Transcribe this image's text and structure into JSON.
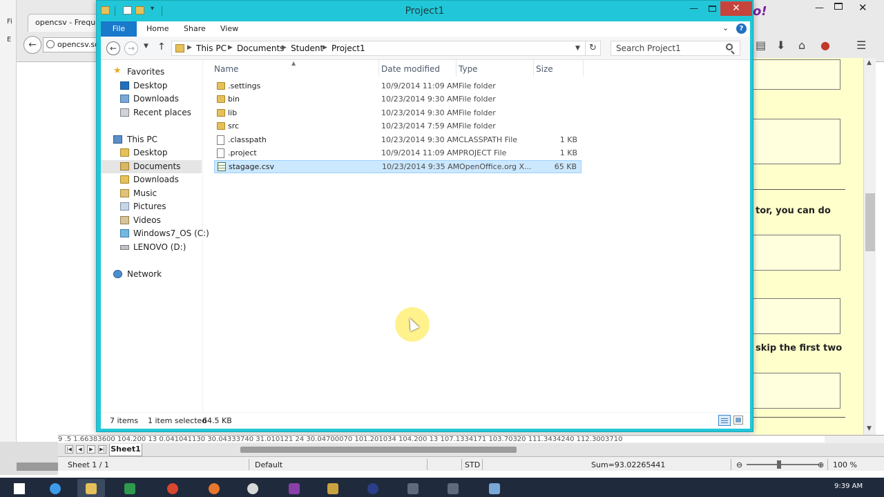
{
  "browser": {
    "menu_letters": [
      "Fi",
      "E"
    ],
    "tab_title": "opencsv - Frequen",
    "url": "opencsv.so",
    "brand_text": "o!",
    "page_text": {
      "line1": "tor, you can do",
      "line2": "skip the first two"
    }
  },
  "explorer": {
    "title": "Project1",
    "close_glyph": "✕",
    "ribbon": {
      "file_tab": "File",
      "tabs": [
        "Home",
        "Share",
        "View"
      ]
    },
    "address": {
      "crumbs": [
        "This PC",
        "Documents",
        "Student",
        "Project1"
      ]
    },
    "search": {
      "placeholder": "Search Project1"
    },
    "nav_pane": {
      "favorites_header": "Favorites",
      "favorites": [
        "Desktop",
        "Downloads",
        "Recent places"
      ],
      "this_pc_header": "This PC",
      "this_pc": [
        "Desktop",
        "Documents",
        "Downloads",
        "Music",
        "Pictures",
        "Videos",
        "Windows7_OS (C:)",
        "LENOVO (D:)"
      ],
      "selected": "Documents",
      "network": "Network"
    },
    "columns": {
      "name": "Name",
      "date": "Date modified",
      "type": "Type",
      "size": "Size"
    },
    "files": [
      {
        "name": ".settings",
        "date": "10/9/2014 11:09 AM",
        "type": "File folder",
        "size": "",
        "icon": "folder-icon"
      },
      {
        "name": "bin",
        "date": "10/23/2014 9:30 AM",
        "type": "File folder",
        "size": "",
        "icon": "folder-icon"
      },
      {
        "name": "lib",
        "date": "10/23/2014 9:30 AM",
        "type": "File folder",
        "size": "",
        "icon": "folder-icon"
      },
      {
        "name": "src",
        "date": "10/23/2014 7:59 AM",
        "type": "File folder",
        "size": "",
        "icon": "folder-icon"
      },
      {
        "name": ".classpath",
        "date": "10/23/2014 9:30 AM",
        "type": "CLASSPATH File",
        "size": "1 KB",
        "icon": "file-icon"
      },
      {
        "name": ".project",
        "date": "10/9/2014 11:09 AM",
        "type": "PROJECT File",
        "size": "1 KB",
        "icon": "file-icon"
      },
      {
        "name": "stagage.csv",
        "date": "10/23/2014 9:35 AM",
        "type": "OpenOffice.org X...",
        "size": "65 KB",
        "icon": "spreadsheet-icon",
        "selected": true
      }
    ],
    "status": {
      "item_count": "7 items",
      "selection": "1 item selected",
      "selection_size": "64.5 KB"
    }
  },
  "spreadsheet": {
    "cells_text": "9 .5     1.66383600     104.200 13     0.041041130     30.04333740     31.010121 24     30.04700070     101.201034     104.200 13     107.1334171     103.70320     111.3434240     112.3003710",
    "sheet_tab": "Sheet1",
    "status": {
      "sheet": "Sheet 1 / 1",
      "style": "Default",
      "mode": "STD",
      "sum": "Sum=93.02265441",
      "zoom": "100 %"
    }
  },
  "taskbar": {
    "clock": "9:39 AM"
  },
  "colors": {
    "explorer_frame": "#21c7d8",
    "close_button": "#c6443c",
    "selection": "#cce8ff",
    "file_tab": "#1979ca",
    "page_yellow": "#ffffcc"
  }
}
